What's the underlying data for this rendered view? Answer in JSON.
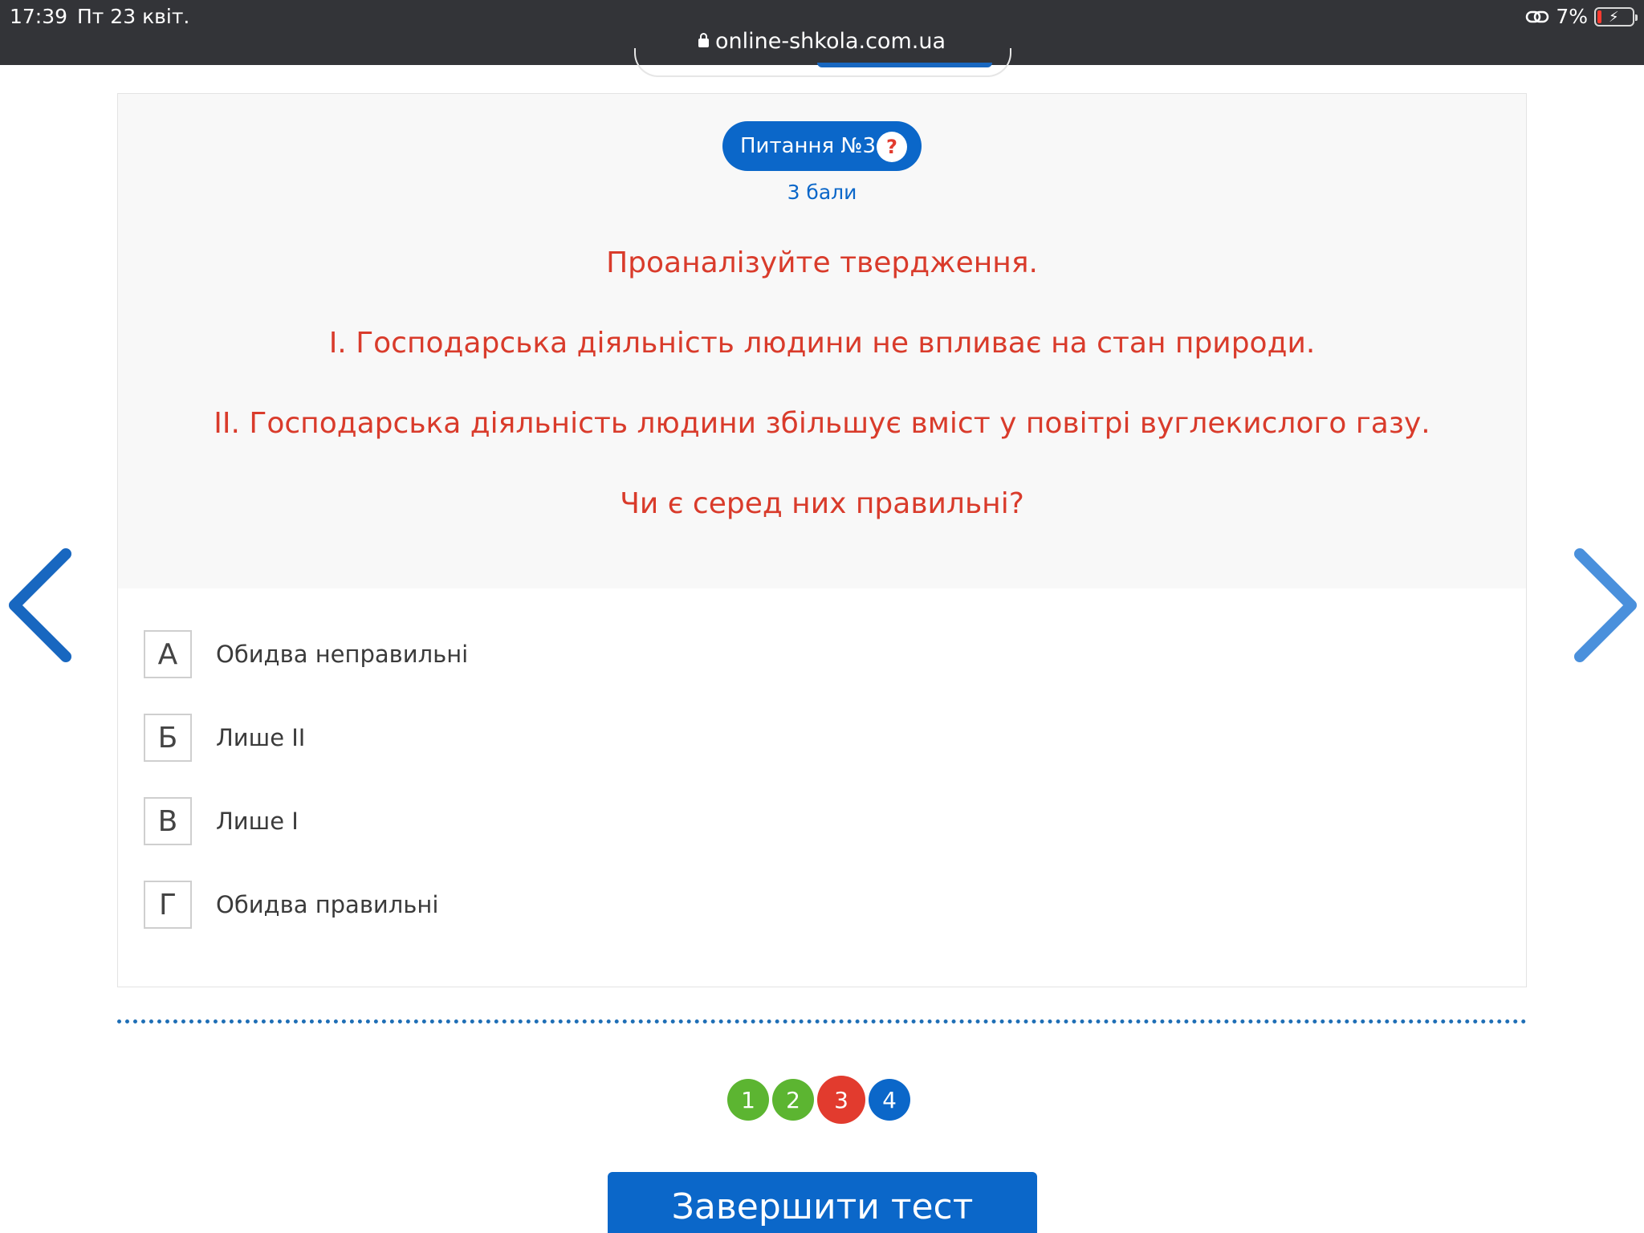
{
  "status_bar": {
    "time": "17:39",
    "date": "Пт 23 квіт.",
    "battery_percent": "7%",
    "battery_level": 0.07,
    "url": "online-shkola.com.ua"
  },
  "question": {
    "badge": "Питання №3",
    "help_symbol": "?",
    "points": "3 бали",
    "lines": [
      "Проаналізуйте твердження.",
      "І. Господарська діяльність людини не впливає на стан природи.",
      "ІІ. Господарська діяльність людини збільшує вміст у повітрі вуглекислого газу.",
      "Чи є серед них правильні?"
    ]
  },
  "answers": [
    {
      "letter": "А",
      "text": "Обидва неправильні"
    },
    {
      "letter": "Б",
      "text": "Лише ІІ"
    },
    {
      "letter": "В",
      "text": "Лише І"
    },
    {
      "letter": "Г",
      "text": "Обидва правильні"
    }
  ],
  "pagination": [
    {
      "label": "1",
      "state": "answered",
      "color": "#5cb531"
    },
    {
      "label": "2",
      "state": "answered",
      "color": "#5cb531"
    },
    {
      "label": "3",
      "state": "current",
      "color": "#e23b2e"
    },
    {
      "label": "4",
      "state": "unanswered",
      "color": "#0b67c9"
    }
  ],
  "finish_button": "Завершити тест",
  "colors": {
    "accent": "#0b67c9",
    "question_text": "#d93b2b",
    "prev_arrow": "#1867c0",
    "next_arrow": "#4a90dc"
  }
}
